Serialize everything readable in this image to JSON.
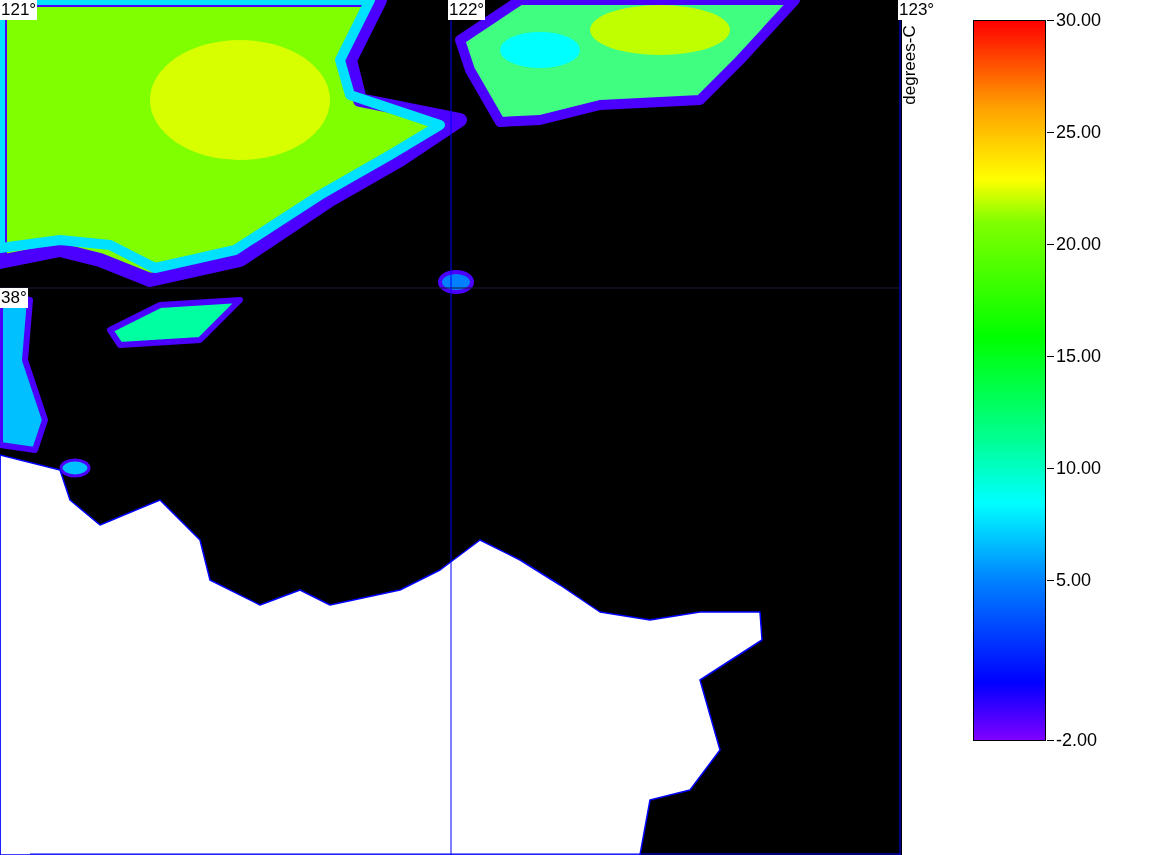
{
  "map": {
    "longitude_labels": [
      "121°",
      "122°",
      "123°"
    ],
    "latitude_labels": [
      "38°"
    ]
  },
  "colorbar": {
    "title": "degrees-C",
    "tick_labels": [
      "30.00",
      "25.00",
      "20.00",
      "15.00",
      "10.00",
      "5.00",
      "-2.00"
    ]
  }
}
